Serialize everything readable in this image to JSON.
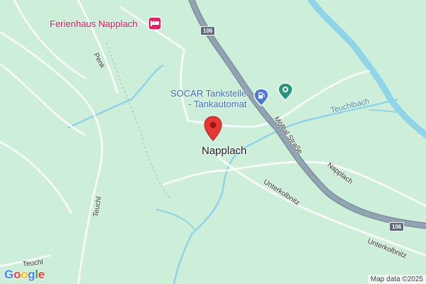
{
  "map": {
    "pois": {
      "ferienhaus": {
        "label": "Ferienhaus Napplach",
        "icon": "hotel-bed-icon",
        "color": "#e91e63"
      },
      "socar": {
        "label_line1": "SOCAR Tankstelle",
        "label_line2": "- Tankautomat",
        "icon": "gas-station-icon",
        "color": "#4a7ad8"
      },
      "green_poi": {
        "icon": "location-pin-icon",
        "color": "#26957a"
      }
    },
    "place_label": "Napplach",
    "selected_pin": {
      "icon": "map-pin-icon",
      "color": "#e53935"
    },
    "roads": {
      "penk": "Penk",
      "teuchl_1": "Teuchl",
      "teuchl_2": "Teuchl",
      "moelltal": "Mölltal Straße",
      "napplach_road": "Napplach",
      "unterkolbnitz_1": "Unterkolbnitz",
      "unterkolbnitz_2": "Unterkolbnitz"
    },
    "shields": {
      "top": "106",
      "bottom_right": "106"
    },
    "water_label": "Teuchlbach",
    "attribution": "Map data ©2025",
    "logo": {
      "text": "Google",
      "letters": [
        "G",
        "o",
        "o",
        "g",
        "l",
        "e"
      ],
      "colors": [
        "#4285F4",
        "#EA4335",
        "#FBBC05",
        "#4285F4",
        "#34A853",
        "#EA4335"
      ]
    },
    "colors": {
      "background": "#cdeed9",
      "highway": "#8a9aa8",
      "river": "#8fd4e8",
      "minor_road": "#ffffff"
    }
  }
}
